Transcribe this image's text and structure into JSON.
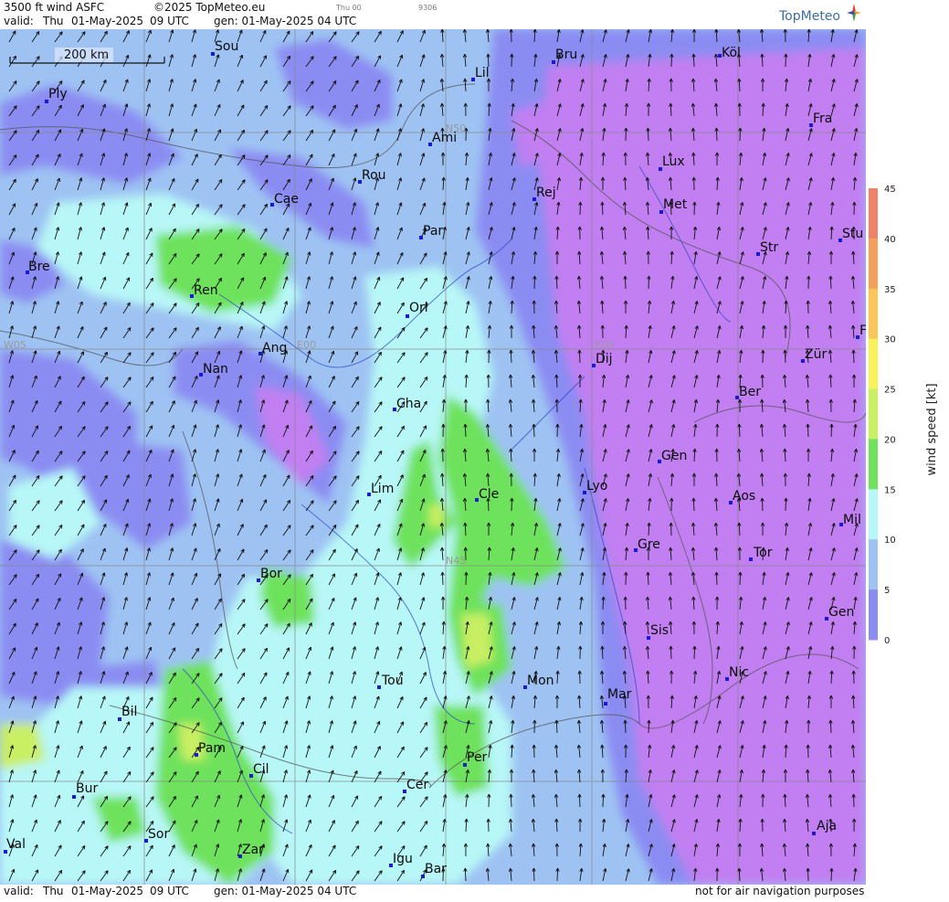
{
  "header": {
    "title": "3500 ft wind ASFC",
    "copyright": "©2025 TopMeteo.eu",
    "run_day": "Thu 00",
    "code": "9306",
    "valid_label": "valid:",
    "valid_day": "Thu",
    "valid_date": "01-May-2025",
    "valid_time": "09 UTC",
    "gen_label": "gen: 01-May-2025 04 UTC",
    "brand": "TopMeteo"
  },
  "footer": {
    "valid_label": "valid:",
    "valid_day": "Thu",
    "valid_date": "01-May-2025",
    "valid_time": "09 UTC",
    "gen_label": "gen: 01-May-2025 04 UTC",
    "disclaimer": "not for air navigation purposes"
  },
  "scale_bar": {
    "label": "200 km"
  },
  "grid_labels": [
    "N50",
    "W05",
    "E00",
    "E05",
    "N45"
  ],
  "cities": [
    "Sou",
    "Bru",
    "Köl",
    "Lil",
    "Ply",
    "Ami",
    "Fra",
    "Lux",
    "Rou",
    "Rej",
    "Cae",
    "Met",
    "Par",
    "Stu",
    "Str",
    "Bre",
    "Ren",
    "Orl",
    "Ang",
    "Zür",
    "Nan",
    "Dij",
    "Ber",
    "Cha",
    "Gen",
    "Lim",
    "Cle",
    "Lyo",
    "Aos",
    "Mil",
    "Gre",
    "Bor",
    "Tor",
    "Gen",
    "Sis",
    "Nic",
    "Tou",
    "Mon",
    "Mar",
    "Bil",
    "Pam",
    "Cil",
    "Per",
    "Cer",
    "Bur",
    "Sor",
    "Val",
    "Zar",
    "Igu",
    "Bar",
    "Aja",
    "F"
  ],
  "legend": {
    "unit_label": "wind speed [kt]",
    "ticks": [
      "45",
      "40",
      "35",
      "30",
      "25",
      "20",
      "15",
      "10",
      "5",
      "0"
    ],
    "colors": [
      "#f0826a",
      "#f5a05a",
      "#fbc55a",
      "#f8f35a",
      "#c9ef63",
      "#6ee25c",
      "#b8f7f7",
      "#9ec3f3",
      "#8b8cf2",
      "#c17ff1"
    ]
  }
}
